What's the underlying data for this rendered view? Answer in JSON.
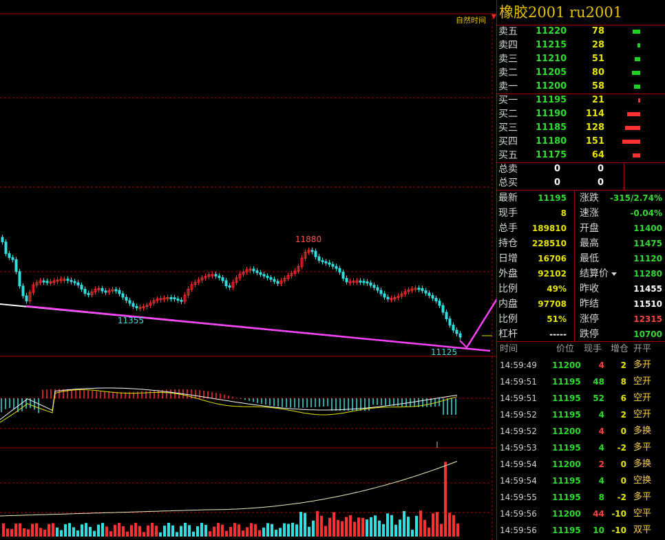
{
  "header": {
    "title": "橡胶2001  ru2001",
    "natural_time_label": "自然时间"
  },
  "chart_labels": {
    "high": "11880",
    "low_left": "11355",
    "low_right": "11125"
  },
  "order_book": {
    "asks": [
      {
        "label": "卖五",
        "price": "11220",
        "volume": "78",
        "bar": 0.38
      },
      {
        "label": "卖四",
        "price": "11215",
        "volume": "28",
        "bar": 0.14
      },
      {
        "label": "卖三",
        "price": "11210",
        "volume": "51",
        "bar": 0.25
      },
      {
        "label": "卖二",
        "price": "11205",
        "volume": "80",
        "bar": 0.4
      },
      {
        "label": "卖一",
        "price": "11200",
        "volume": "58",
        "bar": 0.3
      }
    ],
    "bids": [
      {
        "label": "买一",
        "price": "11195",
        "volume": "21",
        "bar": 0.1
      },
      {
        "label": "买二",
        "price": "11190",
        "volume": "114",
        "bar": 0.62
      },
      {
        "label": "买三",
        "price": "11185",
        "volume": "128",
        "bar": 0.72
      },
      {
        "label": "买四",
        "price": "11180",
        "volume": "151",
        "bar": 0.85
      },
      {
        "label": "买五",
        "price": "11175",
        "volume": "64",
        "bar": 0.35
      }
    ],
    "total_sell": {
      "label": "总卖",
      "a": "0",
      "b": "0"
    },
    "total_buy": {
      "label": "总买",
      "a": "0",
      "b": "0"
    }
  },
  "quote": {
    "left": [
      {
        "label": "最新",
        "value": "11195",
        "color": "green"
      },
      {
        "label": "现手",
        "value": "8",
        "color": "yellow"
      },
      {
        "label": "总手",
        "value": "189810",
        "color": "yellow"
      },
      {
        "label": "持仓",
        "value": "228510",
        "color": "yellow"
      },
      {
        "label": "日增",
        "value": "16706",
        "color": "yellow"
      },
      {
        "label": "外盘",
        "value": "92102",
        "color": "yellow"
      },
      {
        "label": "比例",
        "value": "49%",
        "color": "yellow"
      },
      {
        "label": "内盘",
        "value": "97708",
        "color": "yellow"
      },
      {
        "label": "比例",
        "value": "51%",
        "color": "yellow"
      },
      {
        "label": "杠杆",
        "value": "-----",
        "color": "white"
      }
    ],
    "right": [
      {
        "label": "涨跌",
        "value": "-315/2.74%",
        "color": "green"
      },
      {
        "label": "速涨",
        "value": "-0.04%",
        "color": "green"
      },
      {
        "label": "开盘",
        "value": "11400",
        "color": "green"
      },
      {
        "label": "最高",
        "value": "11475",
        "color": "green"
      },
      {
        "label": "最低",
        "value": "11120",
        "color": "green"
      },
      {
        "label": "结算价",
        "value": "11280",
        "color": "green"
      },
      {
        "label": "昨收",
        "value": "11455",
        "color": "white"
      },
      {
        "label": "昨结",
        "value": "11510",
        "color": "white"
      },
      {
        "label": "涨停",
        "value": "12315",
        "color": "red"
      },
      {
        "label": "跌停",
        "value": "10700",
        "color": "green"
      }
    ]
  },
  "trades": {
    "headers": [
      "时间",
      "价位",
      "现手",
      "增仓",
      "开平"
    ],
    "rows": [
      {
        "time": "14:59:49",
        "price": "11200",
        "vol": "4",
        "vc": "red",
        "oi": "2",
        "type": "多开"
      },
      {
        "time": "14:59:51",
        "price": "11195",
        "vol": "48",
        "vc": "green",
        "oi": "8",
        "type": "空开"
      },
      {
        "time": "14:59:51",
        "price": "11195",
        "vol": "52",
        "vc": "green",
        "oi": "6",
        "type": "空开"
      },
      {
        "time": "14:59:52",
        "price": "11195",
        "vol": "4",
        "vc": "green",
        "oi": "2",
        "type": "空开"
      },
      {
        "time": "14:59:52",
        "price": "11200",
        "vol": "4",
        "vc": "red",
        "oi": "0",
        "type": "多换"
      },
      {
        "time": "14:59:53",
        "price": "11195",
        "vol": "4",
        "vc": "green",
        "oi": "-2",
        "type": "多平"
      },
      {
        "time": "14:59:54",
        "price": "11200",
        "vol": "2",
        "vc": "red",
        "oi": "0",
        "type": "多换"
      },
      {
        "time": "14:59:54",
        "price": "11195",
        "vol": "4",
        "vc": "green",
        "oi": "0",
        "type": "空换"
      },
      {
        "time": "14:59:55",
        "price": "11195",
        "vol": "8",
        "vc": "green",
        "oi": "-2",
        "type": "多平"
      },
      {
        "time": "14:59:56",
        "price": "11200",
        "vol": "44",
        "vc": "red",
        "oi": "-10",
        "type": "空平"
      },
      {
        "time": "14:59:56",
        "price": "11195",
        "vol": "10",
        "vc": "green",
        "oi": "-10",
        "type": "双平"
      }
    ]
  },
  "colors": {
    "up": "#ff3030",
    "down": "#30e0e0",
    "grid": "#b00000",
    "ma": "#e6e600",
    "trend": "#ff40ff"
  }
}
